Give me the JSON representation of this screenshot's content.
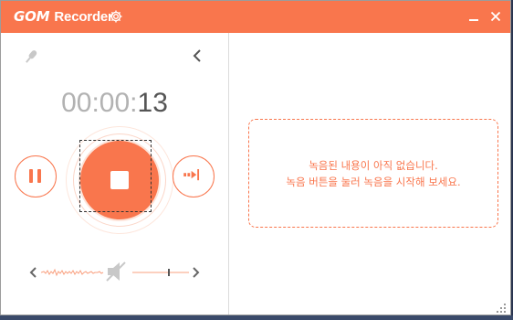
{
  "app": {
    "logo_gom": "GOM",
    "logo_recorder": "Recorder",
    "accent": "#f9764d"
  },
  "titlebar": {
    "settings_icon": "gear-icon",
    "minimize_icon": "minimize-icon",
    "close_icon": "close-icon"
  },
  "recorder": {
    "timer_prefix": "00:00:",
    "timer_seconds": "13",
    "mic_icon": "microphone-icon",
    "collapse_icon": "chevron-left-icon",
    "pause_icon": "pause-icon",
    "stop_icon": "stop-icon",
    "export_icon": "export-arrow-icon",
    "volume": {
      "speaker_icon": "speaker-muted-icon",
      "decrease_icon": "chevron-left-icon",
      "increase_icon": "chevron-right-icon"
    }
  },
  "recordings_panel": {
    "empty_line1": "녹음된 내용이 아직 없습니다.",
    "empty_line2": "녹음 버튼을 눌러 녹음을 시작해 보세요."
  }
}
